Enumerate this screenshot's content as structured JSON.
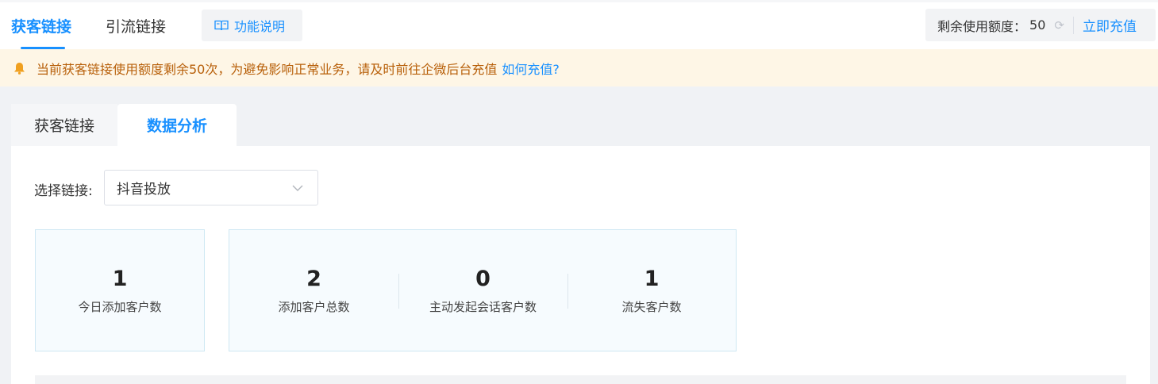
{
  "header": {
    "tabs": [
      {
        "label": "获客链接",
        "active": true
      },
      {
        "label": "引流链接",
        "active": false
      }
    ],
    "func_button": {
      "label": "功能说明",
      "icon": "book-icon"
    },
    "quota": {
      "label": "剩余使用额度：",
      "value": "50",
      "refresh_icon": "refresh-icon",
      "recharge_label": "立即充值"
    }
  },
  "notice": {
    "icon": "bell-icon",
    "text": "当前获客链接使用额度剩余50次，为避免影响正常业务，请及时前往企微后台充值",
    "link": "如何充值?"
  },
  "content_tabs": [
    {
      "label": "获客链接",
      "active": false
    },
    {
      "label": "数据分析",
      "active": true
    }
  ],
  "filter": {
    "label": "选择链接:",
    "selected": "抖音投放",
    "icon": "chevron-down-icon"
  },
  "stats": {
    "today": {
      "value": "1",
      "label": "今日添加客户数"
    },
    "items": [
      {
        "value": "2",
        "label": "添加客户总数"
      },
      {
        "value": "0",
        "label": "主动发起会话客户数"
      },
      {
        "value": "1",
        "label": "流失客户数"
      }
    ]
  },
  "colors": {
    "accent": "#1890ff",
    "notice_bg": "#fef6e6",
    "notice_text": "#b8600a",
    "card_bg": "#f6fbfe",
    "card_border": "#cfe8f3"
  }
}
